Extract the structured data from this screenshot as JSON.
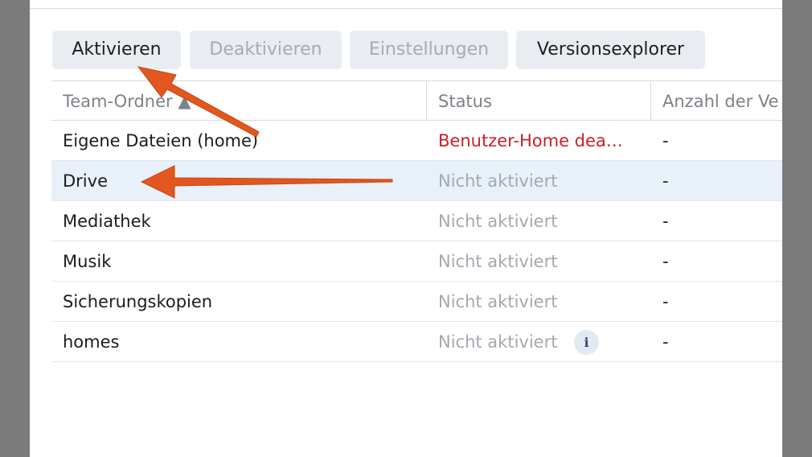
{
  "toolbar": {
    "activate_label": "Aktivieren",
    "deactivate_label": "Deaktivieren",
    "settings_label": "Einstellungen",
    "version_explorer_label": "Versionsexplorer"
  },
  "table": {
    "columns": {
      "name": "Team-Ordner ▲",
      "status": "Status",
      "count": "Anzahl der Ve"
    },
    "rows": [
      {
        "name": "Eigene Dateien (home)",
        "status": "Benutzer-Home dea…",
        "count": "-"
      },
      {
        "name": "Drive",
        "status": "Nicht aktiviert",
        "count": "-"
      },
      {
        "name": "Mediathek",
        "status": "Nicht aktiviert",
        "count": "-"
      },
      {
        "name": "Musik",
        "status": "Nicht aktiviert",
        "count": "-"
      },
      {
        "name": "Sicherungskopien",
        "status": "Nicht aktiviert",
        "count": "-"
      },
      {
        "name": "homes",
        "status": "Nicht aktiviert",
        "count": "-",
        "info_icon": "info-icon"
      }
    ]
  },
  "colors": {
    "selected_row": "#e8f0fa",
    "warning_text": "#c8202a",
    "annotation_arrow": "#e2561f"
  }
}
